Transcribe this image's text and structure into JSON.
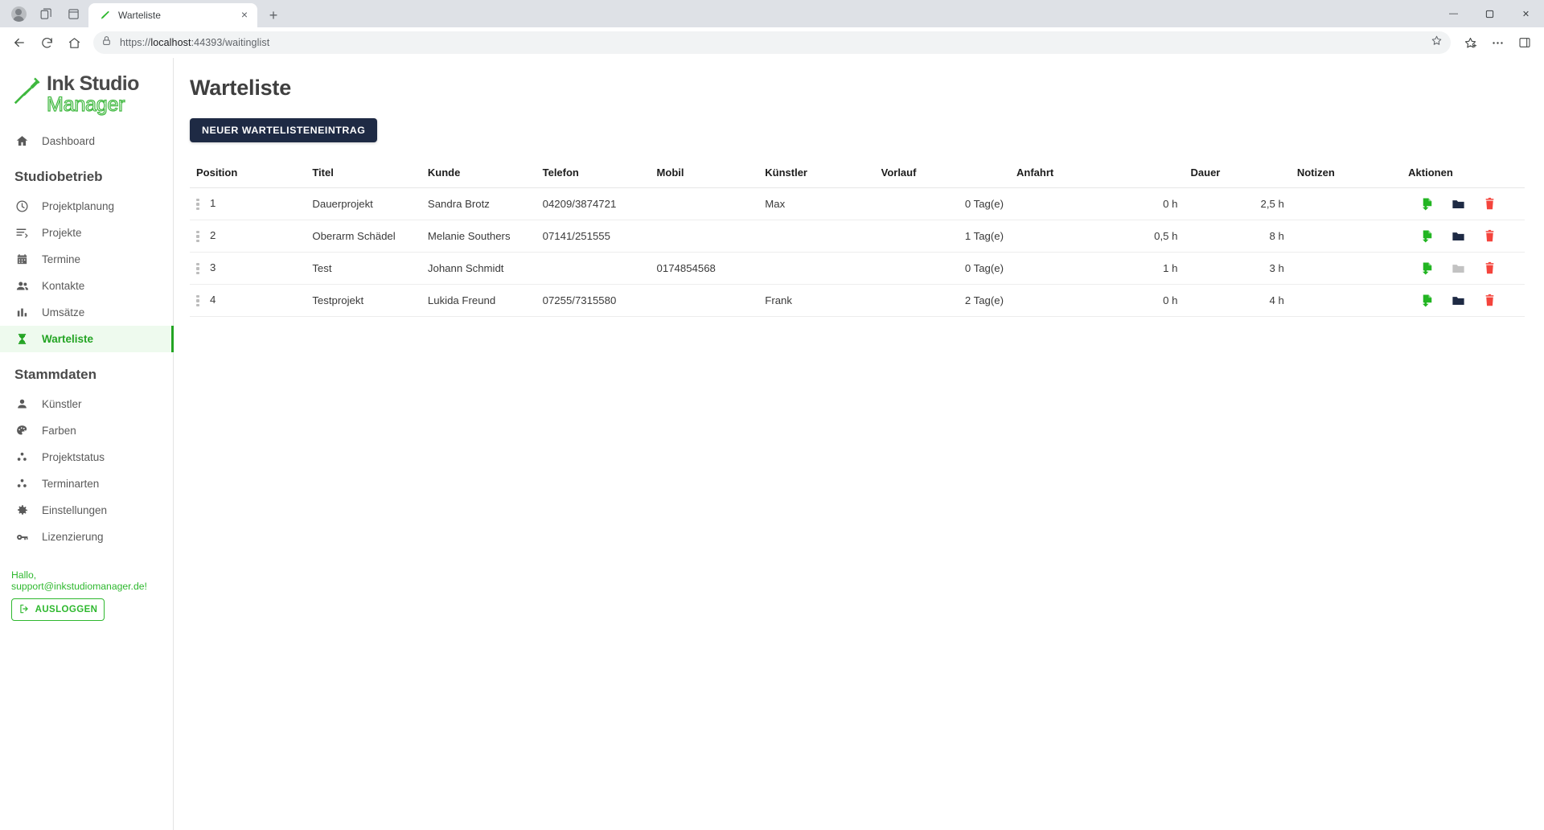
{
  "browser": {
    "tab": {
      "title": "Warteliste",
      "favicon": "tattoo-pen-icon",
      "close": "×"
    },
    "new_tab_label": "+",
    "url_prefix": "https://",
    "url_host": "localhost",
    "url_rest": ":44393/waitinglist",
    "window_controls": {
      "minimize": "—",
      "maximize": "❐",
      "close": "✕"
    },
    "toolbar_icons": [
      "back-arrow",
      "reload",
      "home",
      "lock",
      "bookmark-star",
      "favorites",
      "settings-ellipsis",
      "collections"
    ]
  },
  "sidebar": {
    "logo": {
      "top": "Ink Studio",
      "bottom": "Manager"
    },
    "dashboard": {
      "label": "Dashboard",
      "icon": "home-icon"
    },
    "groups": [
      {
        "title": "Studiobetrieb",
        "items": [
          {
            "label": "Projektplanung",
            "icon": "clock-icon",
            "active": false
          },
          {
            "label": "Projekte",
            "icon": "list-edit-icon",
            "active": false
          },
          {
            "label": "Termine",
            "icon": "calendar-icon",
            "active": false
          },
          {
            "label": "Kontakte",
            "icon": "people-icon",
            "active": false
          },
          {
            "label": "Umsätze",
            "icon": "bar-chart-icon",
            "active": false
          },
          {
            "label": "Warteliste",
            "icon": "hourglass-icon",
            "active": true
          }
        ]
      },
      {
        "title": "Stammdaten",
        "items": [
          {
            "label": "Künstler",
            "icon": "person-icon",
            "active": false
          },
          {
            "label": "Farben",
            "icon": "palette-icon",
            "active": false
          },
          {
            "label": "Projektstatus",
            "icon": "dots-group-icon",
            "active": false
          },
          {
            "label": "Terminarten",
            "icon": "dots-group-icon",
            "active": false
          },
          {
            "label": "Einstellungen",
            "icon": "gear-icon",
            "active": false
          },
          {
            "label": "Lizenzierung",
            "icon": "key-icon",
            "active": false
          }
        ]
      }
    ],
    "greeting": "Hallo, support@inkstudiomanager.de!",
    "logout_label": "AUSLOGGEN",
    "logout_icon": "logout-icon",
    "accent_green": "#2eb82e",
    "active_bg": "#eefaee"
  },
  "main": {
    "page_title": "Warteliste",
    "new_entry_button": "NEUER WARTELISTENEINTRAG",
    "table": {
      "columns": [
        "Position",
        "Titel",
        "Kunde",
        "Telefon",
        "Mobil",
        "Künstler",
        "Vorlauf",
        "Anfahrt",
        "Dauer",
        "Notizen",
        "Aktionen"
      ],
      "rows": [
        {
          "position": "1",
          "titel": "Dauerprojekt",
          "kunde": "Sandra Brotz",
          "telefon": "04209/3874721",
          "mobil": "",
          "kuenstler": "Max",
          "vorlauf": "0 Tag(e)",
          "anfahrt": "0 h",
          "dauer": "2,5 h",
          "notizen": "",
          "folder_enabled": true
        },
        {
          "position": "2",
          "titel": "Oberarm Schädel",
          "kunde": "Melanie Southers",
          "telefon": "07141/251555",
          "mobil": "",
          "kuenstler": "",
          "vorlauf": "1 Tag(e)",
          "anfahrt": "0,5 h",
          "dauer": "8 h",
          "notizen": "",
          "folder_enabled": true
        },
        {
          "position": "3",
          "titel": "Test",
          "kunde": "Johann Schmidt",
          "telefon": "",
          "mobil": "0174854568",
          "kuenstler": "",
          "vorlauf": "0 Tag(e)",
          "anfahrt": "1 h",
          "dauer": "3 h",
          "notizen": "",
          "folder_enabled": false
        },
        {
          "position": "4",
          "titel": "Testprojekt",
          "kunde": "Lukida Freund",
          "telefon": "07255/7315580",
          "mobil": "",
          "kuenstler": "Frank",
          "vorlauf": "2 Tag(e)",
          "anfahrt": "0 h",
          "dauer": "4 h",
          "notizen": "",
          "folder_enabled": true
        }
      ],
      "action_icons": [
        "convert-to-project-icon",
        "open-folder-icon",
        "delete-icon"
      ],
      "colors": {
        "convert": "#22b522",
        "folder_enabled": "#1e2a44",
        "folder_disabled": "#c2c2c2",
        "delete": "#f4443c"
      }
    }
  }
}
